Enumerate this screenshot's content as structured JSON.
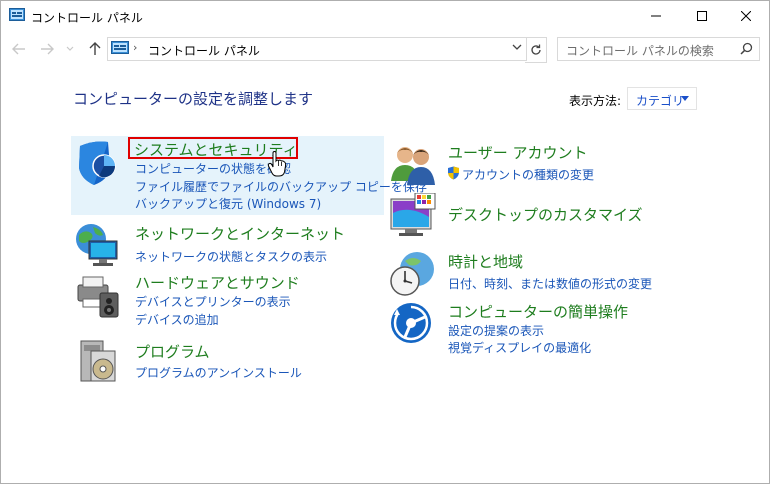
{
  "window": {
    "title": "コントロール パネル"
  },
  "address": {
    "path": "コントロール パネル",
    "search_placeholder": "コントロール パネルの検索"
  },
  "header": {
    "heading": "コンピューターの設定を調整します",
    "view_by_label": "表示方法:",
    "view_by_value": "カテゴリ"
  },
  "categories_left": [
    {
      "title": "システムとセキュリティ",
      "icon": "shield-icon",
      "links": [
        "コンピューターの状態を確認",
        "ファイル履歴でファイルのバックアップ コピーを保存",
        "バックアップと復元 (Windows 7)"
      ]
    },
    {
      "title": "ネットワークとインターネット",
      "icon": "network-globe-icon",
      "links": [
        "ネットワークの状態とタスクの表示"
      ]
    },
    {
      "title": "ハードウェアとサウンド",
      "icon": "printer-speaker-icon",
      "links": [
        "デバイスとプリンターの表示",
        "デバイスの追加"
      ]
    },
    {
      "title": "プログラム",
      "icon": "program-disc-icon",
      "links": [
        "プログラムのアンインストール"
      ]
    }
  ],
  "categories_right": [
    {
      "title": "ユーザー アカウント",
      "icon": "users-icon",
      "links": [
        "アカウントの種類の変更"
      ]
    },
    {
      "title": "デスクトップのカスタマイズ",
      "icon": "desktop-monitor-icon",
      "links": []
    },
    {
      "title": "時計と地域",
      "icon": "clock-globe-icon",
      "links": [
        "日付、時刻、または数値の形式の変更"
      ]
    },
    {
      "title": "コンピューターの簡単操作",
      "icon": "ease-of-access-icon",
      "links": [
        "設定の提案の表示",
        "視覚ディスプレイの最適化"
      ]
    }
  ],
  "colors": {
    "category_title": "#1e7d1e",
    "link": "#1a56b8",
    "heading": "#1e3287",
    "highlight_bg": "#e5f3fb",
    "highlight_border": "#e00000"
  }
}
